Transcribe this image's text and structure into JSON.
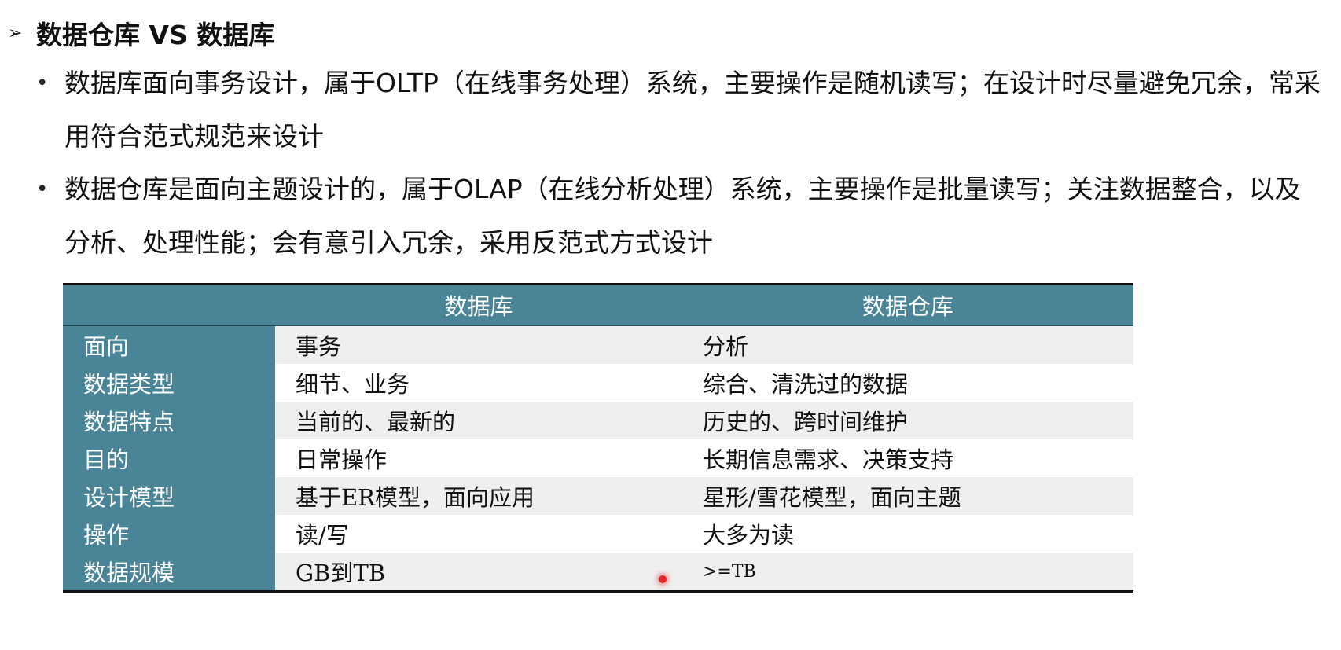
{
  "heading": {
    "arrow": "➢",
    "title": "数据仓库 VS 数据库"
  },
  "bullets": [
    {
      "dot": "•",
      "text": "数据库面向事务设计，属于OLTP（在线事务处理）系统，主要操作是随机读写；在设计时尽量避免冗余，常采用符合范式规范来设计"
    },
    {
      "dot": "•",
      "text": "数据仓库是面向主题设计的，属于OLAP（在线分析处理）系统，主要操作是批量读写；关注数据整合，以及分析、处理性能；会有意引入冗余，采用反范式方式设计"
    }
  ],
  "table": {
    "headers": [
      "",
      "数据库",
      "数据仓库"
    ],
    "rows": [
      [
        "面向",
        "事务",
        "分析"
      ],
      [
        "数据类型",
        "细节、业务",
        "综合、清洗过的数据"
      ],
      [
        "数据特点",
        "当前的、最新的",
        "历史的、跨时间维护"
      ],
      [
        "目的",
        "日常操作",
        "长期信息需求、决策支持"
      ],
      [
        "设计模型",
        "基于ER模型，面向应用",
        "星形/雪花模型，面向主题"
      ],
      [
        "操作",
        "读/写",
        "大多为读"
      ],
      [
        "数据规模",
        "GB到TB",
        ">=TB"
      ]
    ]
  },
  "colors": {
    "header_bg": "#4a8597",
    "row_alt_bg": "#efefef",
    "pointer": "#e02a2a"
  }
}
